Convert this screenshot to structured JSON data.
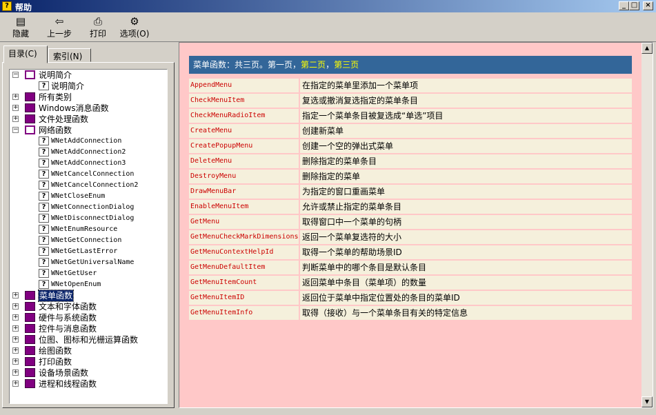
{
  "window": {
    "title": "帮助",
    "controls": {
      "minimize": "_",
      "maximize": "□",
      "close": "×"
    }
  },
  "toolbar": [
    {
      "label": "隐藏",
      "icon": "hide-icon"
    },
    {
      "label": "上一步",
      "icon": "back-arrow-icon"
    },
    {
      "label": "打印",
      "icon": "printer-icon"
    },
    {
      "label": "选项(O)",
      "icon": "options-icon"
    }
  ],
  "tabs": [
    {
      "label": "目录(C)",
      "active": true
    },
    {
      "label": "索引(N)",
      "active": false
    }
  ],
  "tree": [
    {
      "level": 0,
      "type": "book-open",
      "expander": "−",
      "label": "说明简介"
    },
    {
      "level": 1,
      "type": "topic",
      "label": "说明简介"
    },
    {
      "level": 0,
      "type": "book",
      "expander": "+",
      "label": "所有类别"
    },
    {
      "level": 0,
      "type": "book",
      "expander": "+",
      "label": "Windows消息函数"
    },
    {
      "level": 0,
      "type": "book",
      "expander": "+",
      "label": "文件处理函数"
    },
    {
      "level": 0,
      "type": "book-open",
      "expander": "−",
      "label": "网络函数"
    },
    {
      "level": 1,
      "type": "topic",
      "label": "WNetAddConnection"
    },
    {
      "level": 1,
      "type": "topic",
      "label": "WNetAddConnection2"
    },
    {
      "level": 1,
      "type": "topic",
      "label": "WNetAddConnection3"
    },
    {
      "level": 1,
      "type": "topic",
      "label": "WNetCancelConnection"
    },
    {
      "level": 1,
      "type": "topic",
      "label": "WNetCancelConnection2"
    },
    {
      "level": 1,
      "type": "topic",
      "label": "WNetCloseEnum"
    },
    {
      "level": 1,
      "type": "topic",
      "label": "WNetConnectionDialog"
    },
    {
      "level": 1,
      "type": "topic",
      "label": "WNetDisconnectDialog"
    },
    {
      "level": 1,
      "type": "topic",
      "label": "WNetEnumResource"
    },
    {
      "level": 1,
      "type": "topic",
      "label": "WNetGetConnection"
    },
    {
      "level": 1,
      "type": "topic",
      "label": "WNetGetLastError"
    },
    {
      "level": 1,
      "type": "topic",
      "label": "WNetGetUniversalName"
    },
    {
      "level": 1,
      "type": "topic",
      "label": "WNetGetUser"
    },
    {
      "level": 1,
      "type": "topic",
      "label": "WNetOpenEnum"
    },
    {
      "level": 0,
      "type": "book",
      "expander": "+",
      "label": "菜单函数",
      "selected": true
    },
    {
      "level": 0,
      "type": "book",
      "expander": "+",
      "label": "文本和字体函数"
    },
    {
      "level": 0,
      "type": "book",
      "expander": "+",
      "label": "硬件与系统函数"
    },
    {
      "level": 0,
      "type": "book",
      "expander": "+",
      "label": "控件与消息函数"
    },
    {
      "level": 0,
      "type": "book",
      "expander": "+",
      "label": "位图、图标和光栅运算函数"
    },
    {
      "level": 0,
      "type": "book",
      "expander": "+",
      "label": "绘图函数"
    },
    {
      "level": 0,
      "type": "book",
      "expander": "+",
      "label": "打印函数"
    },
    {
      "level": 0,
      "type": "book",
      "expander": "+",
      "label": "设备场景函数"
    },
    {
      "level": 0,
      "type": "book",
      "expander": "+",
      "label": "进程和线程函数"
    }
  ],
  "content": {
    "header": {
      "prefix": "菜单函数：共三页。",
      "page1": "第一页",
      "sep1": "，",
      "page2": "第二页",
      "sep2": "，",
      "page3": "第三页"
    },
    "rows": [
      {
        "func": "AppendMenu",
        "desc": "在指定的菜单里添加一个菜单项"
      },
      {
        "func": "CheckMenuItem",
        "desc": "复选或撤消复选指定的菜单条目"
      },
      {
        "func": "CheckMenuRadioItem",
        "desc": "指定一个菜单条目被复选成“单选”项目"
      },
      {
        "func": "CreateMenu",
        "desc": "创建新菜单"
      },
      {
        "func": "CreatePopupMenu",
        "desc": "创建一个空的弹出式菜单"
      },
      {
        "func": "DeleteMenu",
        "desc": "删除指定的菜单条目"
      },
      {
        "func": "DestroyMenu",
        "desc": "删除指定的菜单"
      },
      {
        "func": "DrawMenuBar",
        "desc": "为指定的窗口重画菜单"
      },
      {
        "func": "EnableMenuItem",
        "desc": "允许或禁止指定的菜单条目"
      },
      {
        "func": "GetMenu",
        "desc": "取得窗口中一个菜单的句柄"
      },
      {
        "func": "GetMenuCheckMarkDimensions",
        "desc": "返回一个菜单复选符的大小"
      },
      {
        "func": "GetMenuContextHelpId",
        "desc": "取得一个菜单的帮助场景ID"
      },
      {
        "func": "GetMenuDefaultItem",
        "desc": "判断菜单中的哪个条目是默认条目"
      },
      {
        "func": "GetMenuItemCount",
        "desc": "返回菜单中条目（菜单项）的数量"
      },
      {
        "func": "GetMenuItemID",
        "desc": "返回位于菜单中指定位置处的条目的菜单ID"
      },
      {
        "func": "GetMenuItemInfo",
        "desc": "取得（接收）与一个菜单条目有关的特定信息"
      }
    ]
  },
  "scrollbar": {
    "up": "▲",
    "down": "▼"
  },
  "colors": {
    "content_bg": "#ffc8c8",
    "header_bg": "#336699",
    "header_link": "#ffff00",
    "function_name": "#cc0000",
    "row_bg": "#f5f0dc",
    "selection": "#0a246a"
  }
}
